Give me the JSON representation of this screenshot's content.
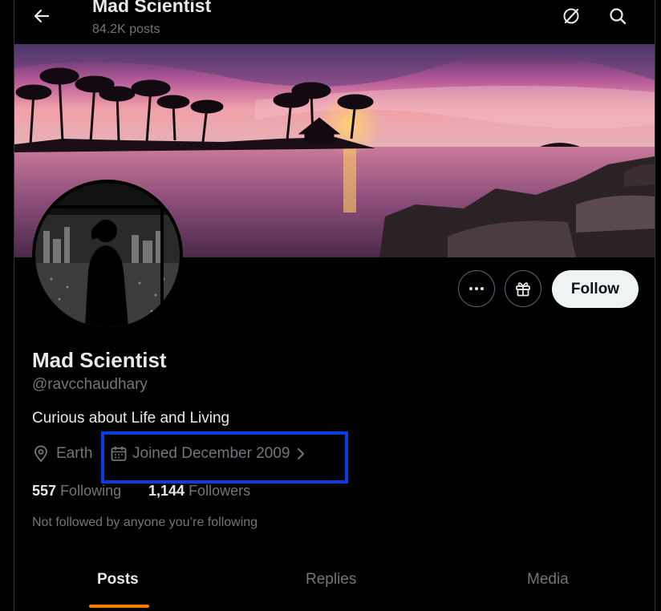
{
  "header": {
    "title": "Mad Scientist",
    "post_count": "84.2K posts",
    "back_icon": "arrow-left-icon",
    "grok_icon": "grok-icon",
    "search_icon": "search-icon"
  },
  "banner": {
    "alt": "tropical sunset beach with palm trees"
  },
  "profile": {
    "name": "Mad Scientist",
    "handle": "@ravcchaudhary",
    "bio": "Curious about Life and Living",
    "location": "Earth",
    "joined": "Joined December 2009",
    "following_count": "557",
    "following_label": "Following",
    "followers_count": "1,144",
    "followers_label": "Followers",
    "not_followed": "Not followed by anyone you’re following"
  },
  "actions": {
    "follow_label": "Follow",
    "more_icon": "more-icon",
    "gift_icon": "gift-icon"
  },
  "tabs": [
    {
      "label": "Posts",
      "active": true
    },
    {
      "label": "Replies",
      "active": false
    },
    {
      "label": "Media",
      "active": false
    }
  ],
  "colors": {
    "accent_underline": "#ff7a00",
    "highlight_box": "#0a3ee0",
    "muted_text": "#71767b"
  }
}
